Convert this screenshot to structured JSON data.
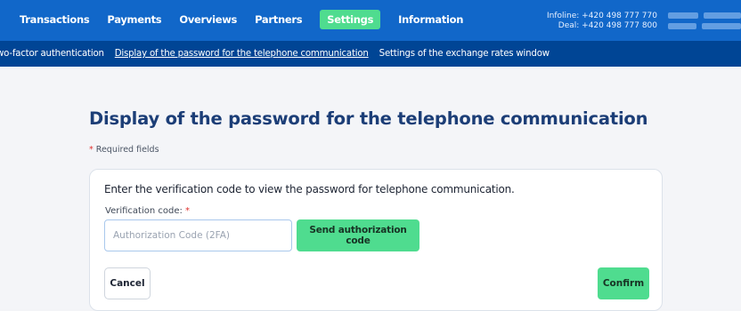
{
  "topnav": {
    "items": [
      "Transactions",
      "Payments",
      "Overviews",
      "Partners",
      "Settings",
      "Information"
    ],
    "active_index": 4
  },
  "contact": {
    "infoline": "Infoline: +420 498 777 770",
    "deal": "Deal: +420 498 777 800"
  },
  "subnav": {
    "items": [
      "wo-factor authentication",
      "Display of the password for the telephone communication",
      "Settings of the exchange rates window"
    ],
    "current_index": 1
  },
  "page": {
    "title": "Display of the password for the telephone communication",
    "required_star": "*",
    "required_note": "Required fields"
  },
  "form": {
    "instruction": "Enter the verification code to view the password for telephone communication.",
    "field_label": "Verification code:",
    "field_star": "*",
    "input_value": "",
    "input_placeholder": "Authorization Code (2FA)",
    "send_label": "Send authorization code",
    "cancel_label": "Cancel",
    "confirm_label": "Confirm"
  },
  "colors": {
    "topbar": "#1167c9",
    "subbar": "#004595",
    "accent_green": "#4fdc8f",
    "title": "#1c3e77",
    "required": "#e0322e"
  }
}
